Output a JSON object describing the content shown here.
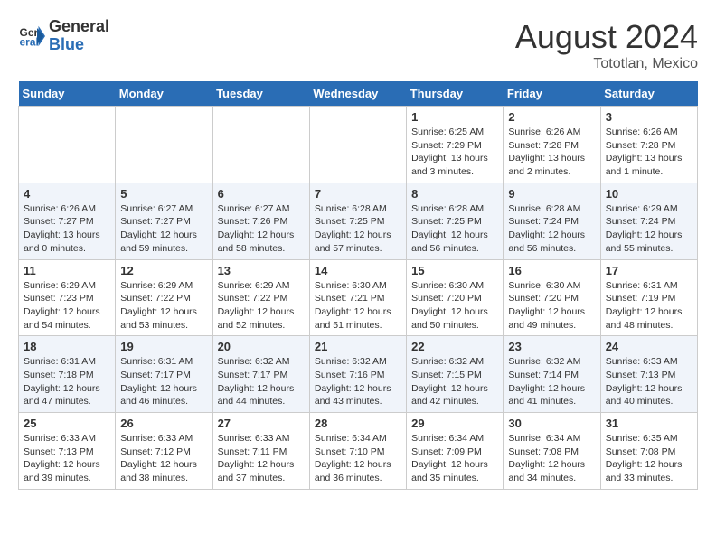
{
  "logo": {
    "general": "General",
    "blue": "Blue"
  },
  "title": "August 2024",
  "location": "Tototlan, Mexico",
  "days_of_week": [
    "Sunday",
    "Monday",
    "Tuesday",
    "Wednesday",
    "Thursday",
    "Friday",
    "Saturday"
  ],
  "weeks": [
    [
      {
        "day": "",
        "info": ""
      },
      {
        "day": "",
        "info": ""
      },
      {
        "day": "",
        "info": ""
      },
      {
        "day": "",
        "info": ""
      },
      {
        "day": "1",
        "info": "Sunrise: 6:25 AM\nSunset: 7:29 PM\nDaylight: 13 hours\nand 3 minutes."
      },
      {
        "day": "2",
        "info": "Sunrise: 6:26 AM\nSunset: 7:28 PM\nDaylight: 13 hours\nand 2 minutes."
      },
      {
        "day": "3",
        "info": "Sunrise: 6:26 AM\nSunset: 7:28 PM\nDaylight: 13 hours\nand 1 minute."
      }
    ],
    [
      {
        "day": "4",
        "info": "Sunrise: 6:26 AM\nSunset: 7:27 PM\nDaylight: 13 hours\nand 0 minutes."
      },
      {
        "day": "5",
        "info": "Sunrise: 6:27 AM\nSunset: 7:27 PM\nDaylight: 12 hours\nand 59 minutes."
      },
      {
        "day": "6",
        "info": "Sunrise: 6:27 AM\nSunset: 7:26 PM\nDaylight: 12 hours\nand 58 minutes."
      },
      {
        "day": "7",
        "info": "Sunrise: 6:28 AM\nSunset: 7:25 PM\nDaylight: 12 hours\nand 57 minutes."
      },
      {
        "day": "8",
        "info": "Sunrise: 6:28 AM\nSunset: 7:25 PM\nDaylight: 12 hours\nand 56 minutes."
      },
      {
        "day": "9",
        "info": "Sunrise: 6:28 AM\nSunset: 7:24 PM\nDaylight: 12 hours\nand 56 minutes."
      },
      {
        "day": "10",
        "info": "Sunrise: 6:29 AM\nSunset: 7:24 PM\nDaylight: 12 hours\nand 55 minutes."
      }
    ],
    [
      {
        "day": "11",
        "info": "Sunrise: 6:29 AM\nSunset: 7:23 PM\nDaylight: 12 hours\nand 54 minutes."
      },
      {
        "day": "12",
        "info": "Sunrise: 6:29 AM\nSunset: 7:22 PM\nDaylight: 12 hours\nand 53 minutes."
      },
      {
        "day": "13",
        "info": "Sunrise: 6:29 AM\nSunset: 7:22 PM\nDaylight: 12 hours\nand 52 minutes."
      },
      {
        "day": "14",
        "info": "Sunrise: 6:30 AM\nSunset: 7:21 PM\nDaylight: 12 hours\nand 51 minutes."
      },
      {
        "day": "15",
        "info": "Sunrise: 6:30 AM\nSunset: 7:20 PM\nDaylight: 12 hours\nand 50 minutes."
      },
      {
        "day": "16",
        "info": "Sunrise: 6:30 AM\nSunset: 7:20 PM\nDaylight: 12 hours\nand 49 minutes."
      },
      {
        "day": "17",
        "info": "Sunrise: 6:31 AM\nSunset: 7:19 PM\nDaylight: 12 hours\nand 48 minutes."
      }
    ],
    [
      {
        "day": "18",
        "info": "Sunrise: 6:31 AM\nSunset: 7:18 PM\nDaylight: 12 hours\nand 47 minutes."
      },
      {
        "day": "19",
        "info": "Sunrise: 6:31 AM\nSunset: 7:17 PM\nDaylight: 12 hours\nand 46 minutes."
      },
      {
        "day": "20",
        "info": "Sunrise: 6:32 AM\nSunset: 7:17 PM\nDaylight: 12 hours\nand 44 minutes."
      },
      {
        "day": "21",
        "info": "Sunrise: 6:32 AM\nSunset: 7:16 PM\nDaylight: 12 hours\nand 43 minutes."
      },
      {
        "day": "22",
        "info": "Sunrise: 6:32 AM\nSunset: 7:15 PM\nDaylight: 12 hours\nand 42 minutes."
      },
      {
        "day": "23",
        "info": "Sunrise: 6:32 AM\nSunset: 7:14 PM\nDaylight: 12 hours\nand 41 minutes."
      },
      {
        "day": "24",
        "info": "Sunrise: 6:33 AM\nSunset: 7:13 PM\nDaylight: 12 hours\nand 40 minutes."
      }
    ],
    [
      {
        "day": "25",
        "info": "Sunrise: 6:33 AM\nSunset: 7:13 PM\nDaylight: 12 hours\nand 39 minutes."
      },
      {
        "day": "26",
        "info": "Sunrise: 6:33 AM\nSunset: 7:12 PM\nDaylight: 12 hours\nand 38 minutes."
      },
      {
        "day": "27",
        "info": "Sunrise: 6:33 AM\nSunset: 7:11 PM\nDaylight: 12 hours\nand 37 minutes."
      },
      {
        "day": "28",
        "info": "Sunrise: 6:34 AM\nSunset: 7:10 PM\nDaylight: 12 hours\nand 36 minutes."
      },
      {
        "day": "29",
        "info": "Sunrise: 6:34 AM\nSunset: 7:09 PM\nDaylight: 12 hours\nand 35 minutes."
      },
      {
        "day": "30",
        "info": "Sunrise: 6:34 AM\nSunset: 7:08 PM\nDaylight: 12 hours\nand 34 minutes."
      },
      {
        "day": "31",
        "info": "Sunrise: 6:35 AM\nSunset: 7:08 PM\nDaylight: 12 hours\nand 33 minutes."
      }
    ]
  ]
}
